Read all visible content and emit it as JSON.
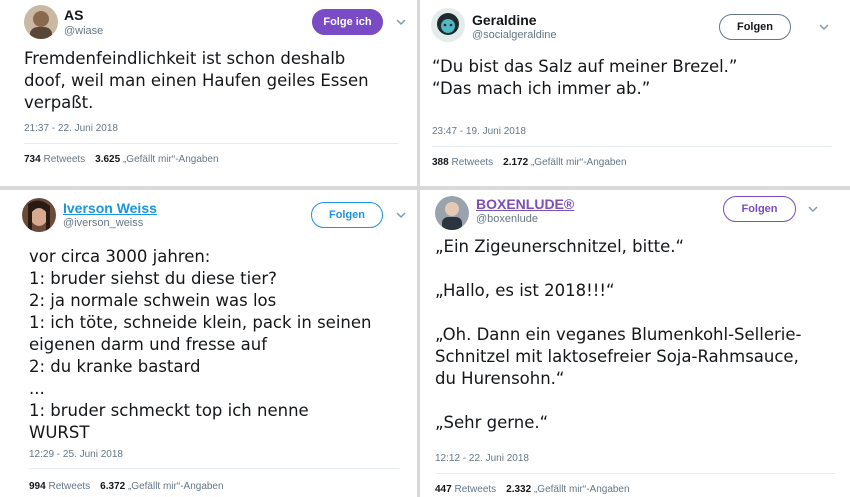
{
  "tweets": [
    {
      "name": "AS",
      "handle": "@wiase",
      "follow_label": "Folge ich",
      "text_lines": [
        "Fremdenfeindlichkeit ist schon deshalb",
        "doof, weil man einen Haufen geiles Essen",
        "verpaßt."
      ],
      "timestamp": "21:37 - 22. Juni 2018",
      "retweets": "734",
      "retweets_label": "Retweets",
      "likes": "3.625",
      "likes_label": "„Gefällt mir“-Angaben"
    },
    {
      "name": "Geraldine",
      "handle": "@socialgeraldine",
      "follow_label": "Folgen",
      "text_lines": [
        "“Du bist das Salz auf meiner Brezel.”",
        "“Das mach ich immer ab.”"
      ],
      "timestamp": "23:47 - 19. Juni 2018",
      "retweets": "388",
      "retweets_label": "Retweets",
      "likes": "2.172",
      "likes_label": "„Gefällt mir“-Angaben"
    },
    {
      "name": "Iverson Weiss",
      "handle": "@iverson_weiss",
      "follow_label": "Folgen",
      "text_lines": [
        "vor circa 3000 jahren:",
        "1: bruder siehst du diese tier?",
        "2: ja normale schwein was los",
        "1: ich töte, schneide klein, pack in seinen",
        "eigenen darm und fresse auf",
        "2: du kranke bastard",
        "...",
        "1: bruder schmeckt top ich nenne",
        "WURST"
      ],
      "timestamp": "12:29 - 25. Juni 2018",
      "retweets": "994",
      "retweets_label": "Retweets",
      "likes": "6.372",
      "likes_label": "„Gefällt mir“-Angaben"
    },
    {
      "name": "BOXENLUDE®",
      "handle": "@boxenlude",
      "follow_label": "Folgen",
      "text_lines": [
        "„Ein Zigeunerschnitzel, bitte.“",
        "",
        "„Hallo, es ist 2018!!!“",
        "",
        "„Oh. Dann ein veganes Blumenkohl-Sellerie-",
        "Schnitzel mit laktosefreier Soja-Rahmsauce,",
        "du Hurensohn.“",
        "",
        "„Sehr gerne.“"
      ],
      "timestamp": "12:12 - 22. Juni 2018",
      "retweets": "447",
      "retweets_label": "Retweets",
      "likes": "2.332",
      "likes_label": "„Gefällt mir“-Angaben"
    }
  ],
  "colors": {
    "accent_blue": "#1b95e0",
    "accent_purple": "#794bc4",
    "muted": "#657786"
  }
}
